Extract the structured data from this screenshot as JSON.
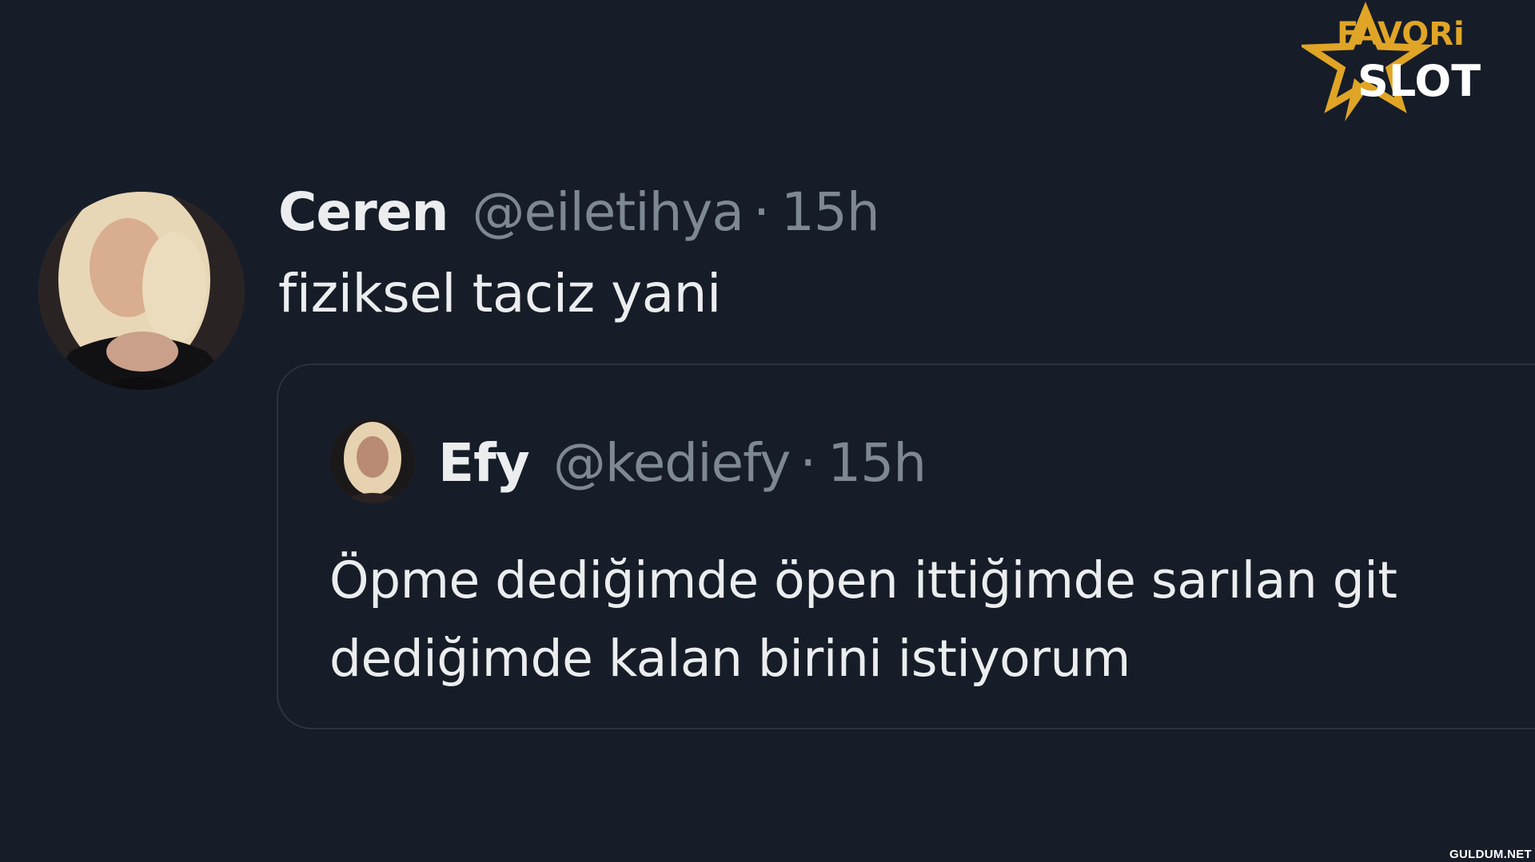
{
  "logo": {
    "line1": "FAVORi",
    "line2": "SLOT",
    "accent_color": "#e0a526",
    "text_color": "#ffffff",
    "icon": "star-icon"
  },
  "tweet": {
    "author_name": "Ceren",
    "author_handle": "@eiletihya",
    "separator": "·",
    "time": "15h",
    "text": "fiziksel taciz yani",
    "avatar": "avatar-photo"
  },
  "quoted_tweet": {
    "author_name": "Efy",
    "author_handle": "@kediefy",
    "separator": "·",
    "time": "15h",
    "text": "Öpme dediğimde öpen ittiğimde sarılan git dediğimde kalan birini istiyorum",
    "avatar": "avatar-photo"
  },
  "watermark": "GULDUM.NET",
  "colors": {
    "background": "#161d28",
    "text_primary": "#ebedee",
    "text_secondary": "#7d8893",
    "card_border": "#2a3340"
  }
}
